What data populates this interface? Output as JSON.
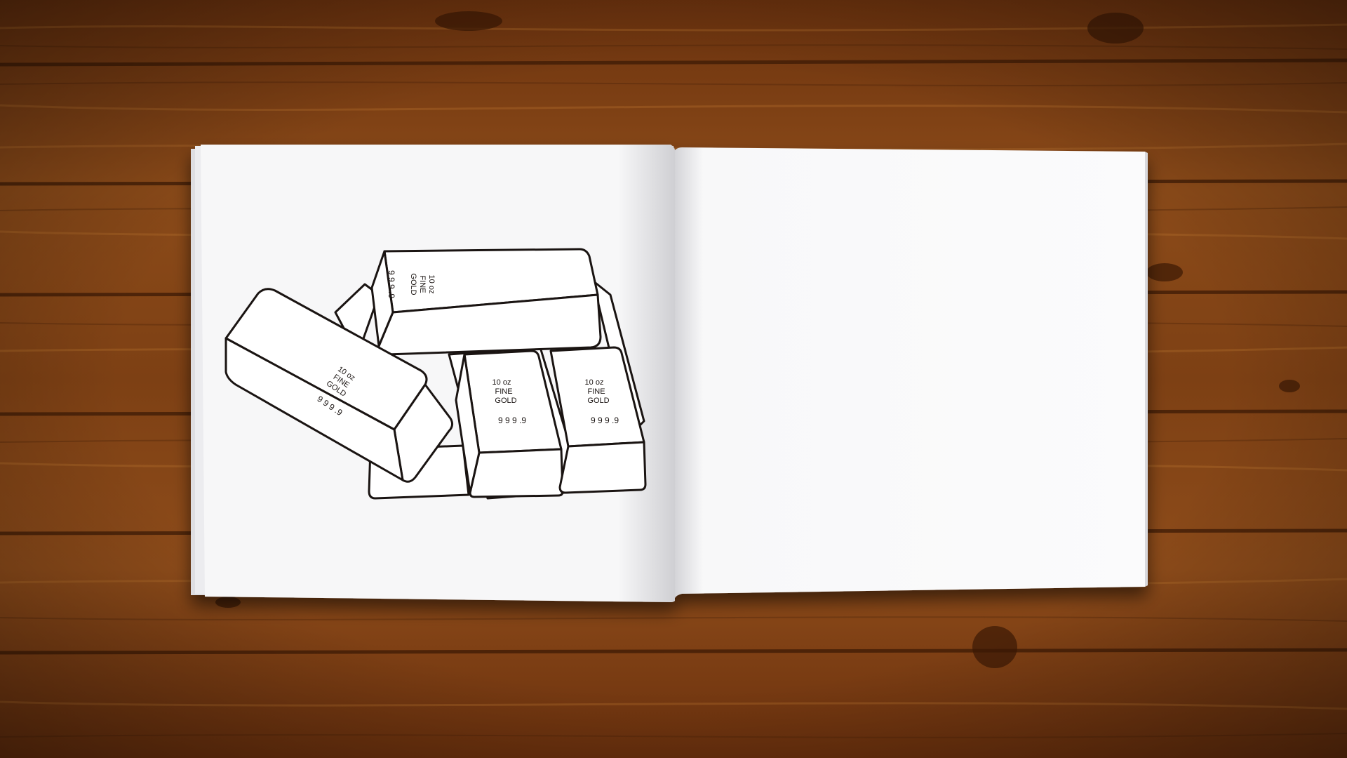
{
  "scene": {
    "description_tag": "open coloring book on wooden table",
    "colors": {
      "wood_dark": "#5e2c0b",
      "wood_mid": "#8a4a18",
      "wood_light": "#b06a2a",
      "paper": "#f7f7f8",
      "ink": "#1a1412"
    }
  },
  "bars": [
    {
      "weight": "10 oz",
      "line2": "FINE",
      "line3": "GOLD",
      "purity": "9 9 9 .9"
    },
    {
      "weight": "10 oz",
      "line2": "FINE",
      "line3": "GOLD",
      "purity": "9 9 9 .9"
    },
    {
      "weight": "10 oz",
      "line2": "FINE",
      "line3": "GOLD",
      "purity": "9 9 9 .9"
    },
    {
      "weight": "10 oz",
      "line2": "FINE",
      "line3": "GOLD",
      "purity": "9 9 9 .9"
    }
  ]
}
